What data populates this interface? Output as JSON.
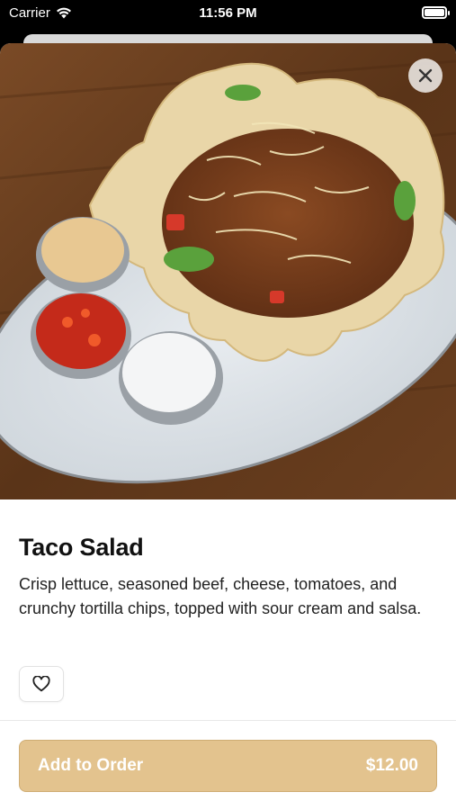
{
  "status_bar": {
    "carrier": "Carrier",
    "time": "11:56 PM"
  },
  "item": {
    "name": "Taco Salad",
    "description": "Crisp lettuce, seasoned beef, cheese, tomatoes, and crunchy tortilla chips, topped with sour cream and salsa.",
    "image_alt": "Taco salad in a tortilla bowl with queso, salsa and sour cream"
  },
  "actions": {
    "add_to_order_label": "Add to Order",
    "price": "$12.00"
  },
  "icons": {
    "wifi": "wifi-icon",
    "battery": "battery-icon",
    "close": "close-icon",
    "favorite": "heart-icon"
  },
  "colors": {
    "primary_button": "#e3c38e",
    "primary_button_text": "#ffffff",
    "title_text": "#111111"
  }
}
